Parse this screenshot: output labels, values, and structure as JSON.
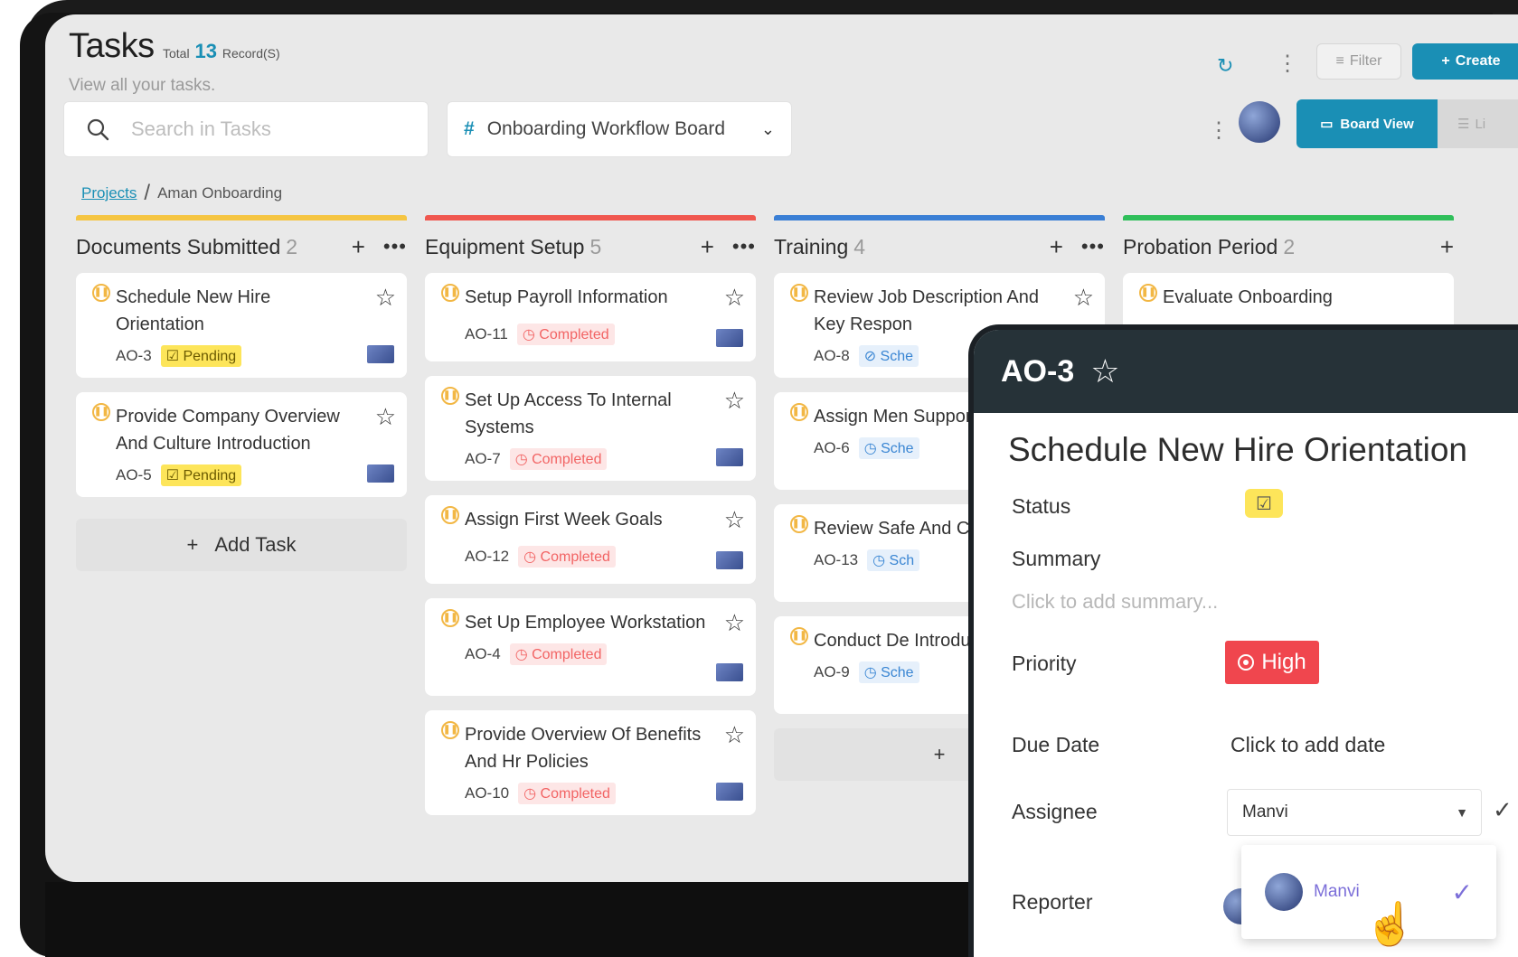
{
  "header": {
    "title": "Tasks",
    "total_label": "Total",
    "total_count": "13",
    "records_label": "Record(S)",
    "subtitle": "View all your tasks.",
    "filter_label": "Filter",
    "create_label": "Create"
  },
  "toolbar": {
    "search_placeholder": "Search in Tasks",
    "board_name": "Onboarding Workflow Board",
    "board_view_label": "Board View",
    "list_view_label": "Li"
  },
  "breadcrumb": {
    "projects": "Projects",
    "current": "Aman Onboarding"
  },
  "colors": {
    "accent": "#1a8fb5",
    "documents": "#f5c542",
    "equipment": "#f0574f",
    "training": "#3a7fd5",
    "probation": "#2fbf5a",
    "priority_high": "#f0464e",
    "pending": "#fde55a"
  },
  "columns": [
    {
      "name": "Documents Submitted",
      "count": "2",
      "add_task_label": "Add Task",
      "cards": [
        {
          "title": "Schedule New Hire Orientation",
          "id": "AO-3",
          "status": "Pending",
          "status_type": "pending"
        },
        {
          "title": "Provide Company Overview And Culture Introduction",
          "id": "AO-5",
          "status": "Pending",
          "status_type": "pending"
        }
      ]
    },
    {
      "name": "Equipment Setup",
      "count": "5",
      "cards": [
        {
          "title": "Setup Payroll Information",
          "id": "AO-11",
          "status": "Completed",
          "status_type": "completed"
        },
        {
          "title": "Set Up Access To Internal Systems",
          "id": "AO-7",
          "status": "Completed",
          "status_type": "completed"
        },
        {
          "title": "Assign First Week Goals",
          "id": "AO-12",
          "status": "Completed",
          "status_type": "completed"
        },
        {
          "title": "Set Up Employee Workstation",
          "id": "AO-4",
          "status": "Completed",
          "status_type": "completed"
        },
        {
          "title": "Provide Overview Of Benefits And Hr Policies",
          "id": "AO-10",
          "status": "Completed",
          "status_type": "completed"
        }
      ]
    },
    {
      "name": "Training",
      "count": "4",
      "cards": [
        {
          "title": "Review Job Description And Key Respon",
          "id": "AO-8",
          "status": "Sche",
          "status_type": "scheduled"
        },
        {
          "title": "Assign Men Support",
          "id": "AO-6",
          "status": "Sche",
          "status_type": "scheduled"
        },
        {
          "title": "Review Safe And Compli",
          "id": "AO-13",
          "status": "Sch",
          "status_type": "scheduled"
        },
        {
          "title": "Conduct De Introduction",
          "id": "AO-9",
          "status": "Sche",
          "status_type": "scheduled"
        }
      ]
    },
    {
      "name": "Probation Period",
      "count": "2",
      "cards": [
        {
          "title": "Evaluate Onboarding",
          "id": "",
          "status": "",
          "status_type": ""
        }
      ]
    }
  ],
  "detail": {
    "id": "AO-3",
    "title": "Schedule New Hire Orientation",
    "status_label": "Status",
    "summary_label": "Summary",
    "summary_placeholder": "Click to add summary...",
    "priority_label": "Priority",
    "priority_value": "High",
    "due_date_label": "Due Date",
    "due_date_value": "Click to add date",
    "assignee_label": "Assignee",
    "assignee_value": "Manvi",
    "assignee_option": "Manvi",
    "reporter_label": "Reporter"
  }
}
